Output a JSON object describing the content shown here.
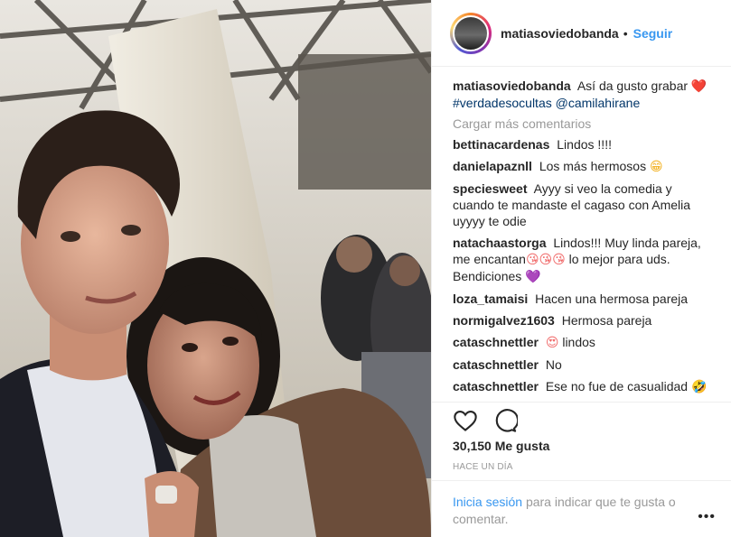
{
  "post": {
    "author": "matiasoviedobanda",
    "follow_label": "Seguir",
    "separator": "•",
    "caption": {
      "user": "matiasoviedobanda",
      "text": "Así da gusto grabar",
      "emoji": "❤️",
      "hashtag": "#verdadesocultas",
      "mention": "@camilahirane"
    },
    "load_more": "Cargar más comentarios",
    "comments": [
      {
        "user": "bettinacardenas",
        "text": "Lindos !!!!"
      },
      {
        "user": "danielapaznll",
        "text": "Los más hermosos",
        "emoji": "😁"
      },
      {
        "user": "speciesweet",
        "text": "Ayyy si veo la comedia y cuando te mandaste el cagaso con Amelia uyyyy te odie"
      },
      {
        "user": "natachaastorga",
        "text_a": "Lindos!!! Muy linda pareja, me encantan",
        "emoji_a": "😘😘😘",
        "text_b": "lo mejor para uds. Bendiciones",
        "emoji_b": "💜"
      },
      {
        "user": "loza_tamaisi",
        "text": "Hacen una hermosa pareja"
      },
      {
        "user": "normigalvez1603",
        "text": "Hermosa pareja"
      },
      {
        "user": "cataschnettler",
        "emoji": "😍",
        "text": "lindos"
      },
      {
        "user": "cataschnettler",
        "text": "No"
      },
      {
        "user": "cataschnettler",
        "text": "Ese no fue de casualidad",
        "emoji": "🤣"
      }
    ],
    "likes": "30,150 Me gusta",
    "time": "HACE UN DÍA",
    "login": {
      "link": "Inicia sesión",
      "rest": "para indicar que te gusta o comentar."
    },
    "options_icon": "more-options-icon",
    "options_glyph": "•••"
  },
  "colors": {
    "accent": "#3897f0",
    "text": "#262626",
    "muted": "#999999",
    "border": "#efefef"
  }
}
